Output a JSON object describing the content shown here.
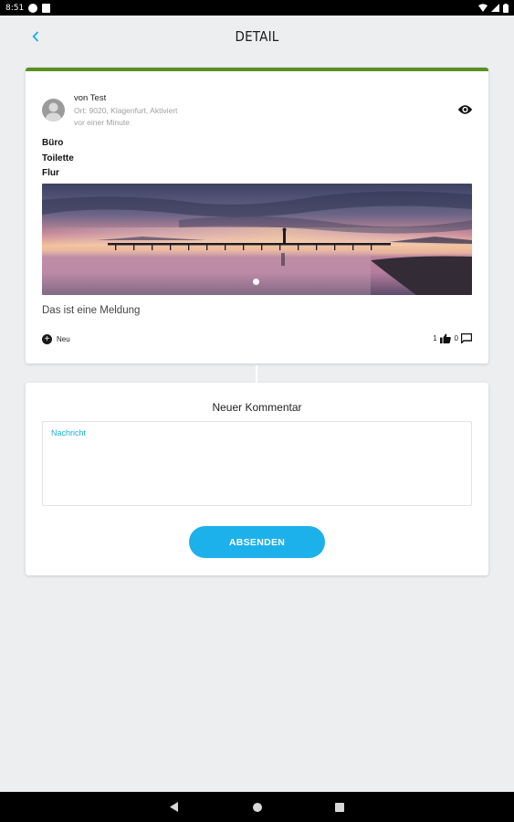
{
  "status_bar": {
    "time": "8:51"
  },
  "header": {
    "title": "DETAIL",
    "back_icon": "chevron-left-icon"
  },
  "post": {
    "author": "von Test",
    "location": "Ort: 9020, Klagenfurt, Aktiviert",
    "time_ago": "vor einer Minute",
    "categories": [
      "Büro",
      "Toilette",
      "Flur"
    ],
    "text": "Das ist eine Meldung",
    "status_label": "Neu",
    "likes": "1",
    "comments": "0",
    "image_page_count": 1,
    "accent_color": "#5a8f22"
  },
  "comment_form": {
    "title": "Neuer Kommentar",
    "message_label": "Nachricht",
    "message_value": "",
    "submit_label": "ABSENDEN",
    "button_color": "#1db1ec"
  }
}
